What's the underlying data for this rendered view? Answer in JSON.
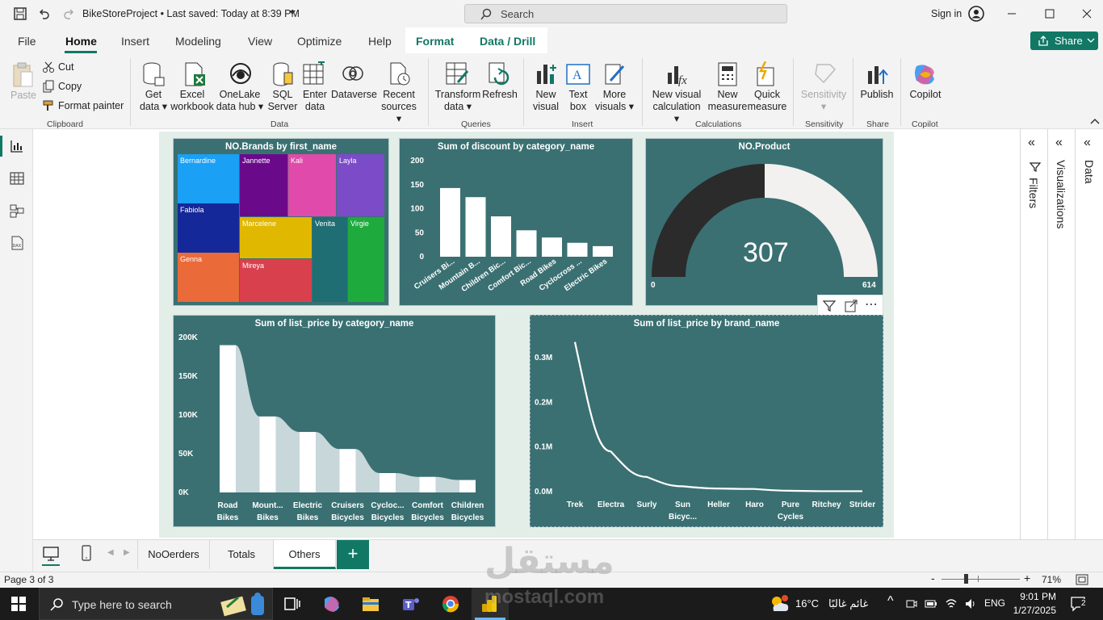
{
  "titlebar": {
    "doc_title": "BikeStoreProject • Last saved: Today at 8:39 PM",
    "search_placeholder": "Search",
    "sign_in": "Sign in"
  },
  "menu": {
    "items": [
      "File",
      "Home",
      "Insert",
      "Modeling",
      "View",
      "Optimize",
      "Help",
      "Format",
      "Data / Drill"
    ],
    "share": "Share"
  },
  "ribbon": {
    "clipboard": {
      "paste": "Paste",
      "cut": "Cut",
      "copy": "Copy",
      "format_painter": "Format painter",
      "group": "Clipboard"
    },
    "data": {
      "get_data_1": "Get",
      "get_data_2": "data",
      "excel_1": "Excel",
      "excel_2": "workbook",
      "onelake_1": "OneLake",
      "onelake_2": "data hub",
      "sql_1": "SQL",
      "sql_2": "Server",
      "enter_1": "Enter",
      "enter_2": "data",
      "dataverse": "Dataverse",
      "recent_1": "Recent",
      "recent_2": "sources",
      "group": "Data"
    },
    "queries": {
      "transform_1": "Transform",
      "transform_2": "data",
      "refresh": "Refresh",
      "group": "Queries"
    },
    "insert": {
      "new_visual_1": "New",
      "new_visual_2": "visual",
      "text_box_1": "Text",
      "text_box_2": "box",
      "more_visuals_1": "More",
      "more_visuals_2": "visuals",
      "group": "Insert"
    },
    "calculations": {
      "nvc_1": "New visual",
      "nvc_2": "calculation",
      "nm_1": "New",
      "nm_2": "measure",
      "qm_1": "Quick",
      "qm_2": "measure",
      "group": "Calculations"
    },
    "sensitivity": {
      "label": "Sensitivity",
      "group": "Sensitivity"
    },
    "share": {
      "publish": "Publish",
      "group": "Share"
    },
    "copilot": {
      "label": "Copilot",
      "group": "Copilot"
    }
  },
  "panes": {
    "filters": "Filters",
    "visualizations": "Visualizations",
    "data": "Data"
  },
  "tabs": [
    "NoOerders",
    "Totals",
    "Others"
  ],
  "status": {
    "page": "Page 3 of 3",
    "zoom": "71%"
  },
  "taskbar": {
    "search_placeholder": "Type here to search",
    "weather_temp": "16°C",
    "weather_text": "غائم غالبًا",
    "lang": "ENG",
    "time": "9:01 PM",
    "date": "1/27/2025",
    "notif": "2"
  },
  "watermark": {
    "ar": "مستقل",
    "en": "mostaql.com"
  },
  "chart_data": [
    {
      "type": "treemap",
      "title": "NO.Brands by first_name",
      "categories": [
        "Bernardine",
        "Fabiola",
        "Genna",
        "Jannette",
        "Kali",
        "Layla",
        "Marcelene",
        "Mireya",
        "Venita",
        "Virgie"
      ],
      "colors": [
        "#1aa0f5",
        "#15289a",
        "#ea6a3a",
        "#6a0a8a",
        "#e04aaa",
        "#7b4bc8",
        "#e0b800",
        "#d9404e",
        "#1e6e73",
        "#1faa3e"
      ]
    },
    {
      "type": "bar",
      "title": "Sum of discount by category_name",
      "categories": [
        "Cruisers Bi...",
        "Mountain B...",
        "Children Bic...",
        "Comfort Bic...",
        "Road Bikes",
        "Cyclocross ...",
        "Electric Bikes"
      ],
      "values": [
        143,
        124,
        84,
        55,
        40,
        29,
        22
      ],
      "yticks": [
        "200",
        "150",
        "100",
        "50",
        "0"
      ],
      "ylim": [
        0,
        200
      ]
    },
    {
      "type": "gauge",
      "title": "NO.Product",
      "value": 307,
      "min": 0,
      "max": 614,
      "value_label": "307",
      "min_label": "0",
      "max_label": "614"
    },
    {
      "type": "area",
      "title": "Sum of list_price by category_name",
      "categories": [
        [
          "Road",
          "Bikes"
        ],
        [
          "Mount...",
          "Bikes"
        ],
        [
          "Electric",
          "Bikes"
        ],
        [
          "Cruisers",
          "Bicycles"
        ],
        [
          "Cycloc...",
          "Bicycles"
        ],
        [
          "Comfort",
          "Bicycles"
        ],
        [
          "Children",
          "Bicycles"
        ]
      ],
      "values": [
        190000,
        98000,
        78000,
        56000,
        25000,
        20000,
        16000
      ],
      "yticks": [
        "200K",
        "150K",
        "100K",
        "50K",
        "0K"
      ],
      "ylim": [
        0,
        200000
      ]
    },
    {
      "type": "line",
      "title": "Sum of list_price by brand_name",
      "categories": [
        [
          "Trek"
        ],
        [
          "Electra"
        ],
        [
          "Surly"
        ],
        [
          "Sun",
          "Bicyc..."
        ],
        [
          "Heller"
        ],
        [
          "Haro"
        ],
        [
          "Pure",
          "Cycles"
        ],
        [
          "Ritchey"
        ],
        [
          "Strider"
        ]
      ],
      "values": [
        0.335,
        0.09,
        0.033,
        0.012,
        0.007,
        0.006,
        0.002,
        0.001,
        0.001
      ],
      "unit": "M",
      "yticks": [
        "0.3M",
        "0.2M",
        "0.1M",
        "0.0M"
      ],
      "ylim": [
        0,
        0.35
      ]
    }
  ]
}
